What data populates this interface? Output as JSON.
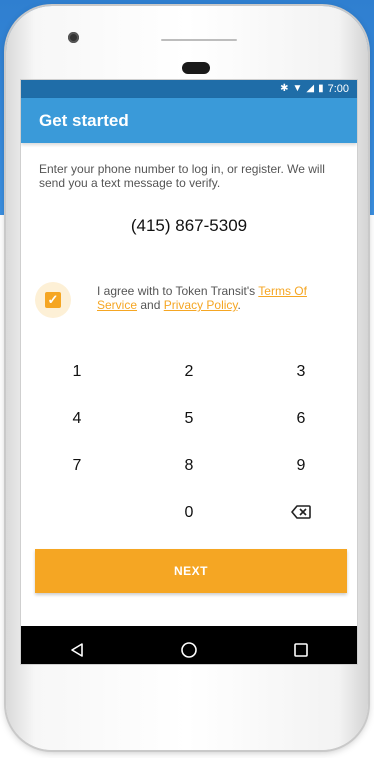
{
  "status_bar": {
    "time": "7:00",
    "icons": [
      "bluetooth-icon",
      "wifi-icon",
      "signal-icon",
      "battery-icon"
    ]
  },
  "app_bar": {
    "title": "Get started"
  },
  "instructions": "Enter your phone number to log in, or register. We will send you a text message to verify.",
  "phone_number": "(415) 867-5309",
  "agreement": {
    "checked": true,
    "prefix": "I agree with to Token Transit's",
    "terms_link": "Terms Of Service",
    "middle": "and",
    "privacy_link": "Privacy Policy",
    "suffix": "."
  },
  "keypad": {
    "keys": [
      "1",
      "2",
      "3",
      "4",
      "5",
      "6",
      "7",
      "8",
      "9",
      "",
      "0",
      "backspace"
    ]
  },
  "next_button": "NEXT",
  "nav_bar": [
    "back-icon",
    "home-icon",
    "recents-icon"
  ],
  "colors": {
    "app_bar": "#3a9ad9",
    "status_bar": "#1f6da8",
    "accent": "#f5a623",
    "nav_bar": "#000000"
  }
}
